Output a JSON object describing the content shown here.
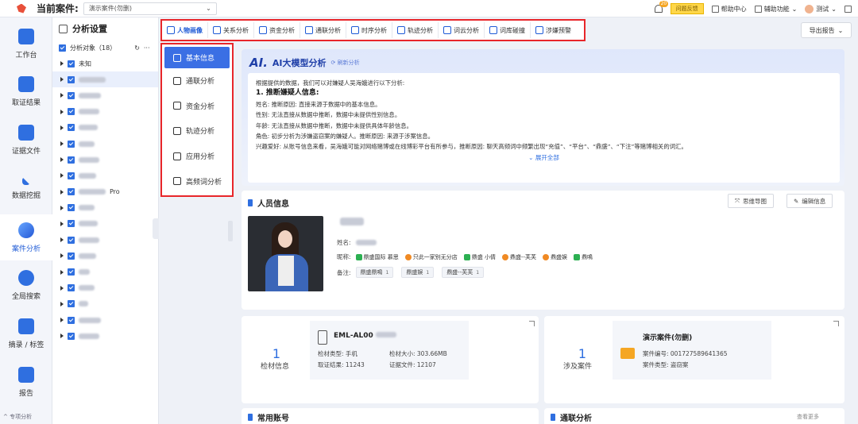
{
  "topbar": {
    "case_label": "当前案件:",
    "case_value": "演示案件(勿删)",
    "notif_count": "20",
    "yellow_btn": "问题反馈",
    "help": "帮助中心",
    "assist": "辅助功能",
    "user": "测试"
  },
  "leftnav": {
    "items": [
      "工作台",
      "取证结果",
      "证据文件",
      "数据挖掘",
      "案件分析",
      "全局搜索",
      "摘录 / 标签",
      "报告"
    ],
    "footer": "专项分析"
  },
  "tree": {
    "title": "分析设置",
    "subject_label": "分析对象（18）",
    "rows": [
      "未知",
      "",
      "",
      "",
      "",
      "",
      "",
      "",
      "Pro",
      "",
      "",
      "",
      "",
      "",
      "",
      "",
      "",
      ""
    ]
  },
  "tabs": [
    "人物画像",
    "关系分析",
    "资金分析",
    "通联分析",
    "时序分析",
    "轨迹分析",
    "词云分析",
    "词库碰撞",
    "涉嫌预警"
  ],
  "export_btn": "导出报告",
  "subnav": [
    "基本信息",
    "通联分析",
    "资金分析",
    "轨迹分析",
    "应用分析",
    "高频词分析"
  ],
  "ai": {
    "logo": "AI.",
    "title": "AI大模型分析",
    "refresh": "刷新分析",
    "intro": "根据提供的数据，我们可以对嫌疑人吴海娥进行以下分析:",
    "heading": "1. 推断嫌疑人信息:",
    "lines": [
      "姓名:          推断原因: 直接来源于数据中的基本信息。",
      "性别: 无法直接从数据中推断，数据中未提供性别信息。",
      "年龄: 无法直接从数据中推断，数据中未提供具体年龄信息。",
      "角色: 初步分析为涉嫌盗窃案的嫌疑人。推断原因: 来源于涉案信息。",
      "兴趣爱好: 从账号信息来看，吴海娥可能对网络赌博或在线博彩平台有所参与，推断原因: 聊天高频词中频繁出现“充值”、“平台”、“鼎盛”、“下注”等赌博相关的词汇。"
    ],
    "expand": "展开全部"
  },
  "person": {
    "title": "人员信息",
    "btn_mind": "思维导图",
    "btn_edit": "编辑信息",
    "name_label": "姓名:",
    "nick_label": "昵称:",
    "nicknames": [
      "鼎盛国际 慕思",
      "只此一家别无分店",
      "鼎盛 小倩",
      "鼎盛--芙芙",
      "鼎盛娱",
      "鼎鳴"
    ],
    "note_label": "备注:",
    "notes": [
      {
        "text": "鼎盛鼎鳴",
        "n": "1"
      },
      {
        "text": "鼎盛娱",
        "n": "1"
      },
      {
        "text": "鼎盛--芙芙",
        "n": "1"
      }
    ]
  },
  "material": {
    "count": "1",
    "label": "检材信息",
    "device": "EML-AL00",
    "type": "检材类型: 手机",
    "size": "检材大小: 303.66MB",
    "result": "取证结果: 11243",
    "evidence": "证据文件: 12107"
  },
  "case": {
    "count": "1",
    "label": "涉及案件",
    "name": "演示案件(勿删)",
    "number": "案件编号: 001727589641365",
    "type": "案件类型: 盗窃案"
  },
  "bottom": {
    "left": "常用账号",
    "right": "通联分析",
    "more": "查看更多"
  }
}
